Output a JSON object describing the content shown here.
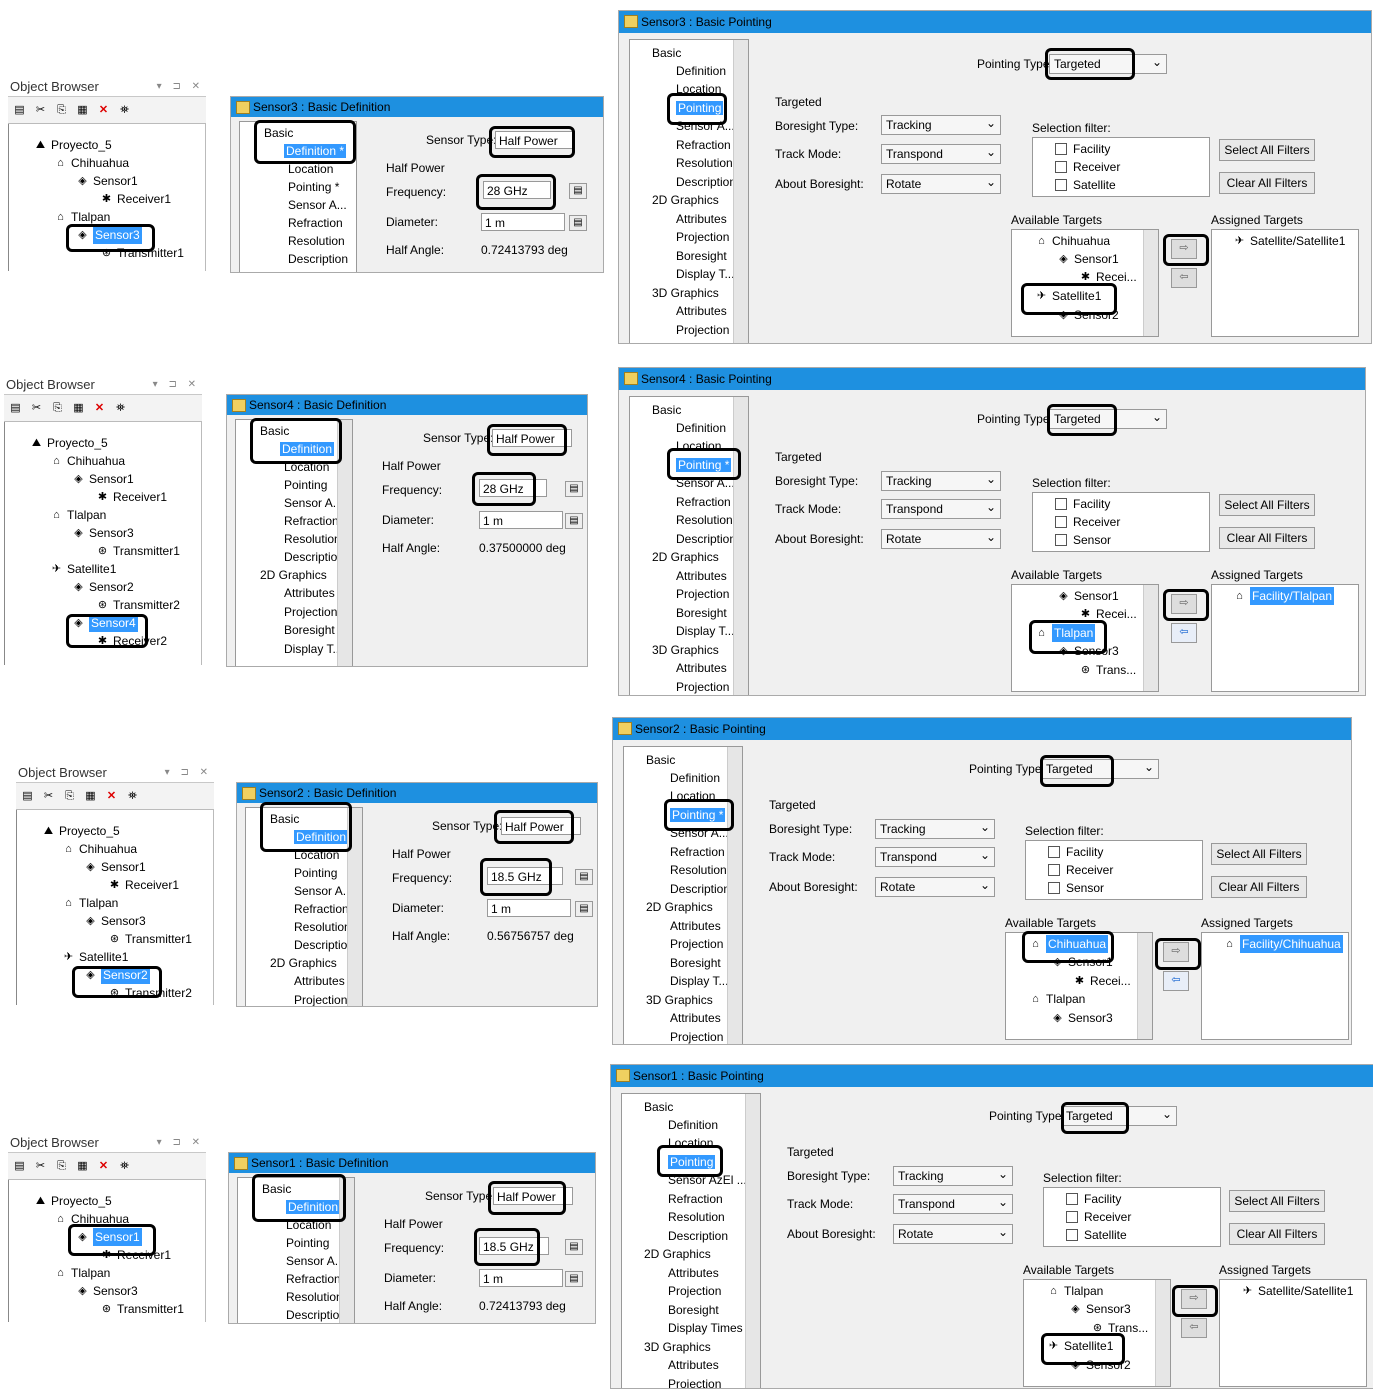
{
  "object_browser": {
    "title": "Object Browser",
    "window_controls": "▾ ⊐ ✕",
    "toolbar_icons": [
      "new-icon",
      "cut-icon",
      "copy-icon",
      "paste-icon",
      "delete-icon",
      "find-icon"
    ]
  },
  "tree": {
    "project": "Proyecto_5",
    "chihuahua": "Chihuahua",
    "sensor1": "Sensor1",
    "receiver1": "Receiver1",
    "tlalpan": "Tlalpan",
    "sensor3": "Sensor3",
    "transmitter1": "Transmitter1",
    "satellite1": "Satellite1",
    "sensor2": "Sensor2",
    "transmitter2": "Transmitter2",
    "sensor4": "Sensor4",
    "receiver2": "Receiver2"
  },
  "nav": {
    "basic": "Basic",
    "definition": "Definition",
    "definition_mod": "Definition *",
    "location": "Location",
    "pointing": "Pointing",
    "pointing_mod": "Pointing *",
    "sensor_az": "Sensor A...",
    "sensor_azel": "Sensor AzEl ...",
    "refraction": "Refraction",
    "resolution": "Resolution",
    "description": "Description",
    "graphics2d": "2D Graphics",
    "attributes": "Attributes",
    "projection": "Projection",
    "boresight": "Boresight",
    "display_t": "Display T...",
    "display_times": "Display Times",
    "graphics3d": "3D Graphics"
  },
  "definition": {
    "sensor_type_label": "Sensor Type:",
    "sensor_type": "Half Power",
    "group": "Half Power",
    "frequency_label": "Frequency:",
    "diameter_label": "Diameter:",
    "half_angle_label": "Half Angle:",
    "diameter": "1 m",
    "s3": {
      "title": "Sensor3 : Basic Definition",
      "frequency": "28 GHz",
      "half_angle": "0.72413793 deg"
    },
    "s4": {
      "title": "Sensor4 : Basic Definition",
      "frequency": "28 GHz",
      "half_angle": "0.37500000 deg"
    },
    "s2": {
      "title": "Sensor2 : Basic Definition",
      "frequency": "18.5 GHz",
      "half_angle": "0.56756757 deg"
    },
    "s1": {
      "title": "Sensor1 : Basic Definition",
      "frequency": "18.5 GHz",
      "half_angle": "0.72413793 deg"
    }
  },
  "pointing": {
    "pointing_type_label": "Pointing Type:",
    "pointing_type": "Targeted",
    "targeted_group": "Targeted",
    "boresight_type_label": "Boresight Type:",
    "boresight_type": "Tracking",
    "track_mode_label": "Track Mode:",
    "track_mode": "Transpond",
    "about_boresight_label": "About Boresight:",
    "about_boresight": "Rotate",
    "selection_filter_label": "Selection filter:",
    "filter_facility": "Facility",
    "filter_receiver": "Receiver",
    "filter_satellite": "Satellite",
    "filter_sensor": "Sensor",
    "select_all": "Select All Filters",
    "clear_all": "Clear All Filters",
    "available_targets": "Available Targets",
    "assigned_targets": "Assigned Targets",
    "recei": "Recei...",
    "trans": "Trans...",
    "trans_cut": "Trans",
    "s3": {
      "title": "Sensor3 : Basic Pointing",
      "assigned": "Satellite/Satellite1"
    },
    "s4": {
      "title": "Sensor4 : Basic Pointing",
      "assigned": "Facility/Tlalpan"
    },
    "s2": {
      "title": "Sensor2 : Basic Pointing",
      "assigned": "Facility/Chihuahua"
    },
    "s1": {
      "title": "Sensor1 : Basic Pointing",
      "assigned": "Satellite/Satellite1"
    }
  }
}
